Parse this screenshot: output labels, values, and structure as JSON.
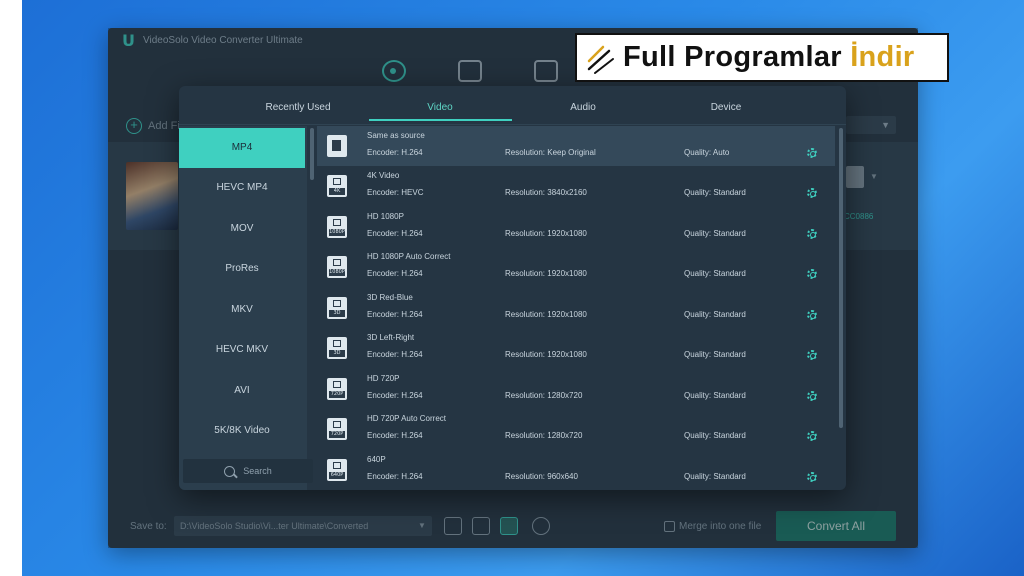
{
  "app": {
    "title": "VideoSolo Video Converter Ultimate",
    "add_file_label": "Add Fi",
    "file_size": "CC0886"
  },
  "tabs": [
    {
      "label": "Recently Used",
      "active": false
    },
    {
      "label": "Video",
      "active": true
    },
    {
      "label": "Audio",
      "active": false
    },
    {
      "label": "Device",
      "active": false
    }
  ],
  "formats": [
    {
      "label": "MP4",
      "active": true
    },
    {
      "label": "HEVC MP4",
      "active": false
    },
    {
      "label": "MOV",
      "active": false
    },
    {
      "label": "ProRes",
      "active": false
    },
    {
      "label": "MKV",
      "active": false
    },
    {
      "label": "HEVC MKV",
      "active": false
    },
    {
      "label": "AVI",
      "active": false
    },
    {
      "label": "5K/8K Video",
      "active": false
    }
  ],
  "search": {
    "placeholder": "Search"
  },
  "presets": [
    {
      "name": "Same as source",
      "encoder": "Encoder: H.264",
      "resolution": "Resolution: Keep Original",
      "quality": "Quality: Auto",
      "badge": "",
      "icon": "page-icon",
      "selected": true
    },
    {
      "name": "4K Video",
      "encoder": "Encoder: HEVC",
      "resolution": "Resolution: 3840x2160",
      "quality": "Quality: Standard",
      "badge": "4K",
      "icon": "video-4k-icon",
      "selected": false
    },
    {
      "name": "HD 1080P",
      "encoder": "Encoder: H.264",
      "resolution": "Resolution: 1920x1080",
      "quality": "Quality: Standard",
      "badge": "1080P",
      "icon": "video-1080p-icon",
      "selected": false
    },
    {
      "name": "HD 1080P Auto Correct",
      "encoder": "Encoder: H.264",
      "resolution": "Resolution: 1920x1080",
      "quality": "Quality: Standard",
      "badge": "1080P",
      "icon": "video-1080p-icon",
      "selected": false
    },
    {
      "name": "3D Red-Blue",
      "encoder": "Encoder: H.264",
      "resolution": "Resolution: 1920x1080",
      "quality": "Quality: Standard",
      "badge": "3D",
      "icon": "video-3d-icon",
      "selected": false
    },
    {
      "name": "3D Left-Right",
      "encoder": "Encoder: H.264",
      "resolution": "Resolution: 1920x1080",
      "quality": "Quality: Standard",
      "badge": "3D",
      "icon": "video-3d-icon",
      "selected": false
    },
    {
      "name": "HD 720P",
      "encoder": "Encoder: H.264",
      "resolution": "Resolution: 1280x720",
      "quality": "Quality: Standard",
      "badge": "720P",
      "icon": "video-720p-icon",
      "selected": false
    },
    {
      "name": "HD 720P Auto Correct",
      "encoder": "Encoder: H.264",
      "resolution": "Resolution: 1280x720",
      "quality": "Quality: Standard",
      "badge": "720P",
      "icon": "video-720p-icon",
      "selected": false
    },
    {
      "name": "640P",
      "encoder": "Encoder: H.264",
      "resolution": "Resolution: 960x640",
      "quality": "Quality: Standard",
      "badge": "640P",
      "icon": "video-640p-icon",
      "selected": false
    }
  ],
  "bottom": {
    "save_label": "Save to:",
    "save_path": "D:\\VideoSolo Studio\\Vi...ter Ultimate\\Converted",
    "merge_label": "Merge into one file",
    "convert_label": "Convert All"
  },
  "watermark": {
    "text_plain": "Full Programlar ",
    "text_accent": "İndir"
  },
  "colors": {
    "accent": "#3fd0c0",
    "panel_bg": "#253543",
    "sidebar_bg": "#2b3e4d",
    "convert_bg": "#1e7d6e",
    "brand_accent": "#d9a21c"
  }
}
